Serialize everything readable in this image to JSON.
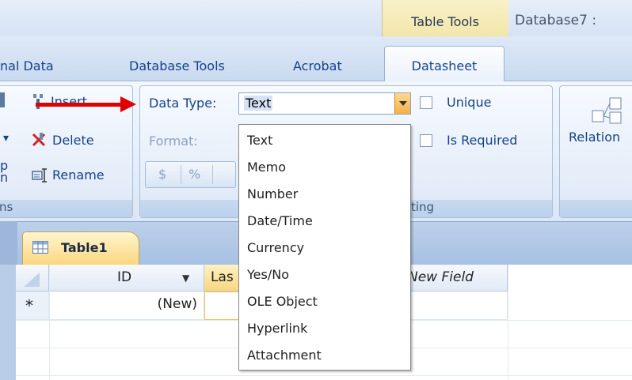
{
  "title_bar": {
    "contextual_group": "Table Tools",
    "database_title": "Database7 :"
  },
  "tabs": [
    {
      "label": "nal Data"
    },
    {
      "label": "Database Tools"
    },
    {
      "label": "Acrobat"
    },
    {
      "label": "Datasheet",
      "active": true
    }
  ],
  "ribbon": {
    "fields_group": {
      "insert": "Insert",
      "delete": "Delete",
      "rename": "Rename",
      "left_fragment_1": "p",
      "left_fragment_2": "n",
      "footer": "ns"
    },
    "formatting_group": {
      "data_type_label": "Data Type:",
      "data_type_value": "Text",
      "format_label": "Format:",
      "currency_symbol": "$",
      "percent_symbol": "%",
      "unique_label": "Unique",
      "is_required_label": "Is Required",
      "footer": "ting"
    },
    "relationships_group": {
      "label": "Relation"
    }
  },
  "dropdown": {
    "options": [
      "Text",
      "Memo",
      "Number",
      "Date/Time",
      "Currency",
      "Yes/No",
      "OLE Object",
      "Hyperlink",
      "Attachment"
    ]
  },
  "document": {
    "tab_label": "Table1",
    "columns": [
      {
        "label": "ID"
      },
      {
        "label": "Las"
      },
      {
        "label": "New Field"
      }
    ],
    "new_row_marker": "*",
    "new_row_value": "(New)"
  },
  "colors": {
    "arrow": "#e00000",
    "ribbon_text": "#15428b",
    "context_tab": "#f1e4a2"
  }
}
